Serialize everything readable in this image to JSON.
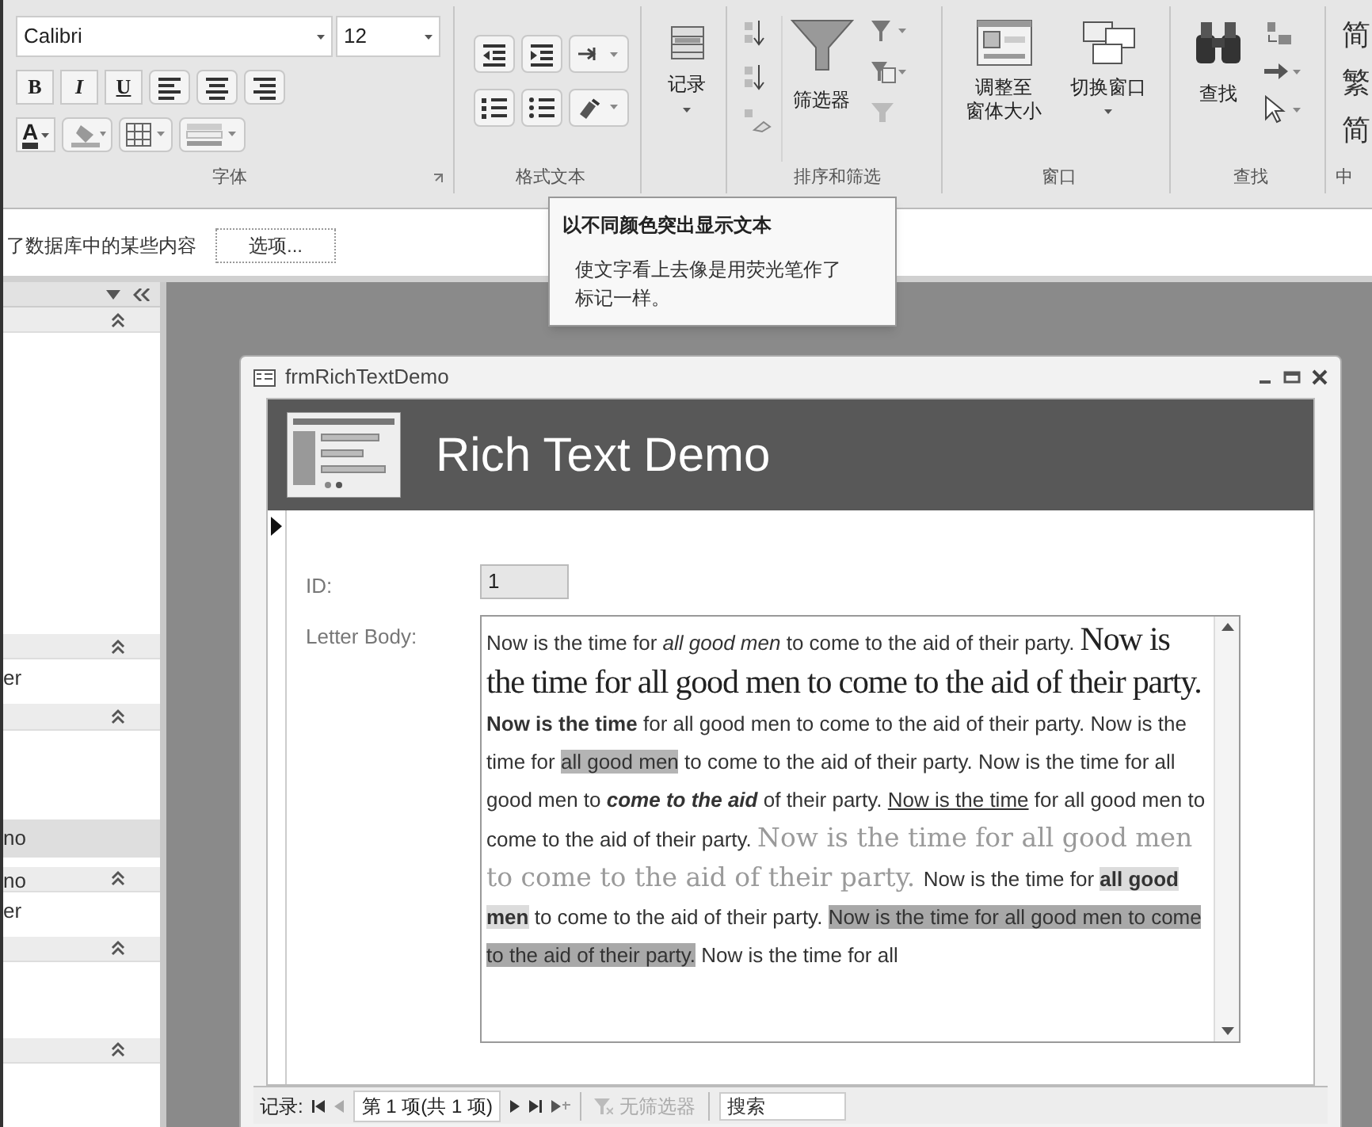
{
  "ribbon": {
    "font": {
      "name": "Calibri",
      "size": "12",
      "format_buttons": [
        "B",
        "I",
        "U"
      ],
      "font_color_button": "A",
      "label": "字体"
    },
    "rich_text": {
      "label": "格式文本"
    },
    "records": {
      "button": "记录"
    },
    "sort_filter": {
      "filter_button": "筛选器",
      "label": "排序和筛选"
    },
    "window": {
      "size_to_fit_lines": [
        "调整至",
        "窗体大小"
      ],
      "switch_windows": "切换窗口",
      "label": "窗口"
    },
    "find": {
      "button": "查找",
      "label": "查找"
    },
    "chinese": {
      "glyphs": [
        "简",
        "繁",
        "简"
      ],
      "label": "中"
    }
  },
  "message_bar": {
    "text": "了数据库中的某些内容",
    "button": "选项..."
  },
  "tooltip": {
    "title": "以不同颜色突出显示文本",
    "body": "使文字看上去像是用荧光笔作了标记一样。"
  },
  "nav_pane": {
    "sections": [
      {
        "expanded": true
      },
      {
        "expanded": true,
        "items": [
          {
            "label": "er",
            "selected": false
          }
        ]
      },
      {
        "expanded": true,
        "items": [
          {
            "label": "no",
            "selected": true
          }
        ]
      },
      {
        "expanded": true,
        "items": [
          {
            "label": "no",
            "selected": false
          },
          {
            "label": "er",
            "selected": false
          }
        ]
      },
      {
        "expanded": true
      },
      {
        "expanded": true
      }
    ]
  },
  "form": {
    "title": "frmRichTextDemo",
    "header": "Rich Text Demo",
    "id_label": "ID:",
    "id_value": "1",
    "body_label": "Letter Body:",
    "body_runs": [
      {
        "kind": "normal",
        "text": "Now is the time for "
      },
      {
        "kind": "italic",
        "text": "all good men"
      },
      {
        "kind": "normal",
        "text": " to come to the aid of their party. "
      },
      {
        "kind": "serif_large",
        "text": "Now is the time for all good men to come to the aid of their party. "
      },
      {
        "kind": "bold",
        "text": "Now is the time"
      },
      {
        "kind": "normal",
        "text": " for all good men to come to the aid of their party.  Now is the time for "
      },
      {
        "kind": "highlight",
        "text": "all good men"
      },
      {
        "kind": "normal",
        "text": " to come to the aid of their party.  Now is the time for all good men to "
      },
      {
        "kind": "bold_italic",
        "text": "come to the aid"
      },
      {
        "kind": "normal",
        "text": " of their party.  "
      },
      {
        "kind": "underline",
        "text": "Now is the time"
      },
      {
        "kind": "normal",
        "text": " for all good men to come to the aid of their party. "
      },
      {
        "kind": "serif_gray",
        "text": "Now is the time for all good men to come to the aid of their party. "
      },
      {
        "kind": "normal",
        "text": " Now is the time for "
      },
      {
        "kind": "highlight_light",
        "text": "all good men"
      },
      {
        "kind": "normal",
        "text": " to come to the aid of their party.  "
      },
      {
        "kind": "highlight_dark",
        "text": "Now is the time for all good men to come to the aid of their party."
      },
      {
        "kind": "normal",
        "text": " Now is the time for all"
      }
    ],
    "record_nav": {
      "label": "记录:",
      "position": "第 1 项(共 1 项)",
      "filter": "无筛选器",
      "filter_disabled": true,
      "search_placeholder": "搜索"
    }
  }
}
